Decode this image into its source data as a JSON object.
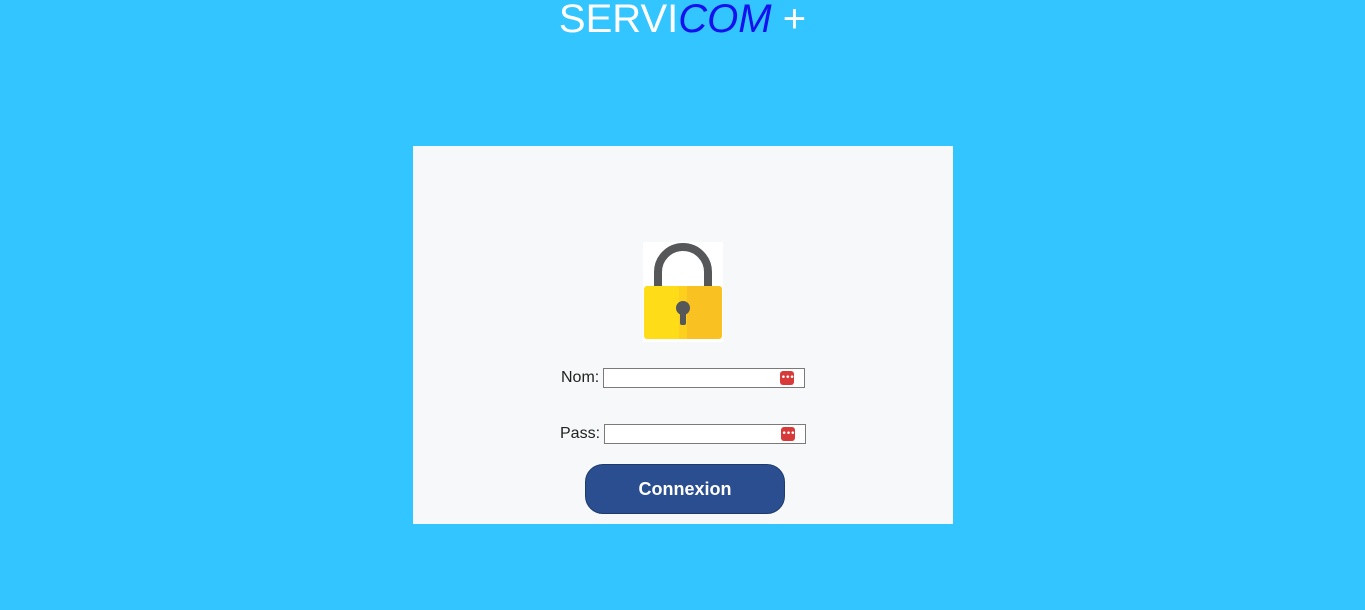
{
  "brand": {
    "part1": "SERVI",
    "part2": "COM",
    "part3": " +"
  },
  "login": {
    "lock_icon": "padlock-icon",
    "username_label": "Nom:",
    "username_value": "",
    "password_label": "Pass:",
    "password_value": "",
    "field_icon": "password-manager-icon",
    "submit_label": "Connexion"
  },
  "colors": {
    "background": "#33c5ff",
    "panel": "#f6f8f9",
    "brand_accent": "#1410ee",
    "button": "#2a4e8f",
    "field_icon": "#d83a3a"
  }
}
